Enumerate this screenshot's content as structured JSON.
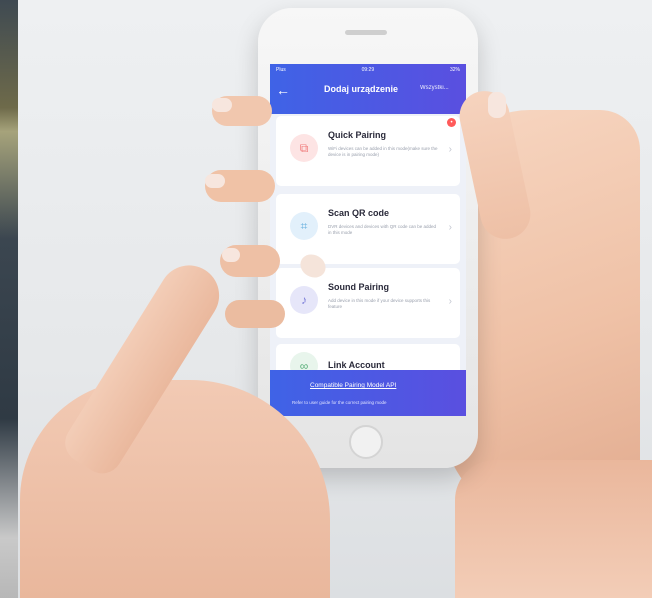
{
  "phone": {
    "status": {
      "carrier": "Plus",
      "time": "09:29",
      "battery": "32%"
    },
    "header": {
      "title": "Dodaj urządzenie",
      "right_action": "Wszystki..."
    },
    "cards": [
      {
        "title": "Quick Pairing",
        "desc": "WiFi devices can be added in this mode(make sure the device is in pairing mode)",
        "icon": "quick-pair-icon",
        "badge": true
      },
      {
        "title": "Scan QR code",
        "desc": "DVR devices and devices with QR code can be added in this mode",
        "icon": "qr-scan-icon",
        "badge": false
      },
      {
        "title": "Sound Pairing",
        "desc": "Add device in this mode if your device supports this feature",
        "icon": "sound-icon",
        "badge": false
      },
      {
        "title": "Link Account",
        "desc": "",
        "icon": "link-icon",
        "badge": false
      }
    ],
    "footer": {
      "link": "Compatible Pairing Model API",
      "note": "Refer to user guide for the correct pairing mode"
    }
  }
}
